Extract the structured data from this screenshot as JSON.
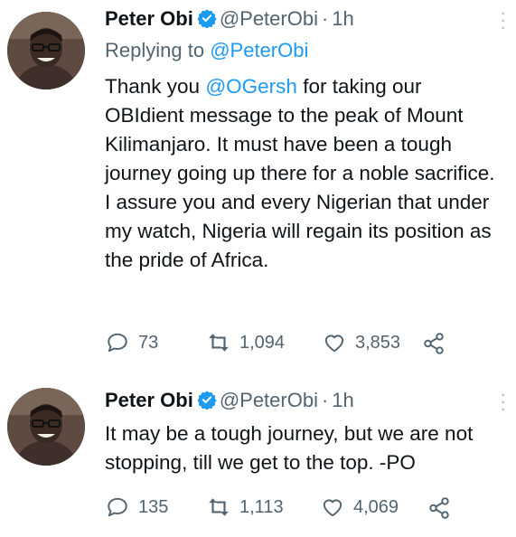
{
  "tweets": [
    {
      "author": "Peter Obi",
      "handle": "@PeterObi",
      "separator": "·",
      "time": "1h",
      "replying_prefix": "Replying to",
      "replying_handle": "@PeterObi",
      "text_before_mention": "Thank you ",
      "mention": "@OGersh",
      "text_after_mention": " for taking our OBIdient message to the peak of Mount Kilimanjaro. It must have been a tough journey going up there for a noble sacrifice. I assure you and every Nigerian that under my watch, Nigeria will regain its position as the pride of Africa.",
      "replies": "73",
      "retweets": "1,094",
      "likes": "3,853"
    },
    {
      "author": "Peter Obi",
      "handle": "@PeterObi",
      "separator": "·",
      "time": "1h",
      "text": "It may be a tough journey, but we are not stopping, till we get to the top. -PO",
      "replies": "135",
      "retweets": "1,113",
      "likes": "4,069"
    }
  ],
  "icons": {
    "verified": "verified-badge-icon",
    "more": "more-options-icon",
    "reply": "reply-icon",
    "retweet": "retweet-icon",
    "like": "heart-icon",
    "share": "share-icon"
  },
  "colors": {
    "text": "#0f1419",
    "secondary": "#536471",
    "accent": "#1d9bf0"
  }
}
